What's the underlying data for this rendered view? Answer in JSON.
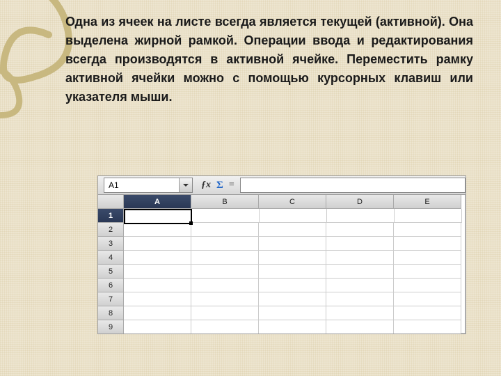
{
  "paragraph": "Одна из ячеек на листе всегда является текущей (активной). Она выделена жирной рамкой. Операции ввода и редактирования всегда производятся в активной ячейке. Переместить рамку активной ячейки можно с помощью курсорных клавиш или указателя мыши.",
  "spreadsheet": {
    "name_box_value": "A1",
    "fx_label": "ƒx",
    "sigma_label": "Σ",
    "eq_label": "=",
    "columns": [
      "A",
      "B",
      "C",
      "D",
      "E"
    ],
    "rows": [
      "1",
      "2",
      "3",
      "4",
      "5",
      "6",
      "7",
      "8",
      "9"
    ],
    "selected_column": "A",
    "selected_row": "1"
  }
}
